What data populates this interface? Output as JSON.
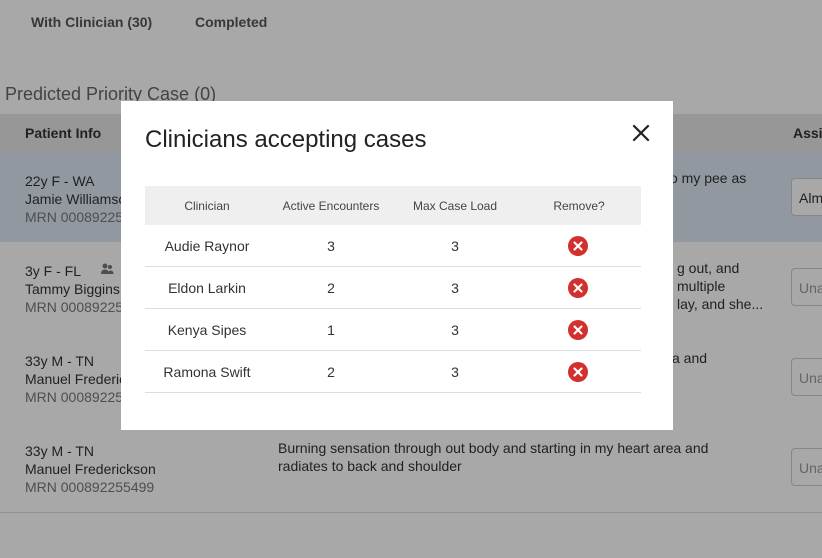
{
  "tabs": [
    {
      "label": "With Clinician (30)"
    },
    {
      "label": "Completed"
    }
  ],
  "section": {
    "title": "Predicted Priority Case (0)"
  },
  "table": {
    "headers": {
      "patient_info": "Patient Info",
      "assign": "Assig"
    },
    "rows": [
      {
        "line1": "22y F - WA",
        "name": "Jamie Williamso",
        "mrn": "MRN 00089225",
        "concern": "o my pee as",
        "assign": "Alm"
      },
      {
        "line1": "3y F - FL",
        "name": "Tammy Biggins",
        "mrn": "MRN 00089225",
        "concern_lines": [
          "g out, and",
          "multiple",
          "lay, and she..."
        ],
        "assign": "Una"
      },
      {
        "line1": "33y M - TN",
        "name": "Manuel Frederic",
        "mrn": "MRN 00089225",
        "concern": "a and",
        "assign": "Una"
      },
      {
        "line1": "33y M - TN",
        "name": "Manuel Frederickson",
        "mrn": "MRN 000892255499",
        "concern": "Burning sensation through  out body and starting in my heart area and radiates to back and shoulder",
        "assign": "Una"
      }
    ]
  },
  "modal": {
    "title": "Clinicians accepting cases",
    "headers": {
      "clinician": "Clinician",
      "active": "Active Encounters",
      "max": "Max Case Load",
      "remove": "Remove?"
    },
    "rows": [
      {
        "clinician": "Audie Raynor",
        "active": "3",
        "max": "3"
      },
      {
        "clinician": "Eldon Larkin",
        "active": "2",
        "max": "3"
      },
      {
        "clinician": "Kenya Sipes",
        "active": "1",
        "max": "3"
      },
      {
        "clinician": "Ramona Swift",
        "active": "2",
        "max": "3"
      }
    ]
  },
  "icons": {
    "close": "close-icon",
    "remove": "remove-circle-icon",
    "group": "group-icon"
  },
  "colors": {
    "remove": "#d32f2f",
    "selected_row": "#dde7f3",
    "overlay": "rgba(0,0,0,0.34)"
  }
}
